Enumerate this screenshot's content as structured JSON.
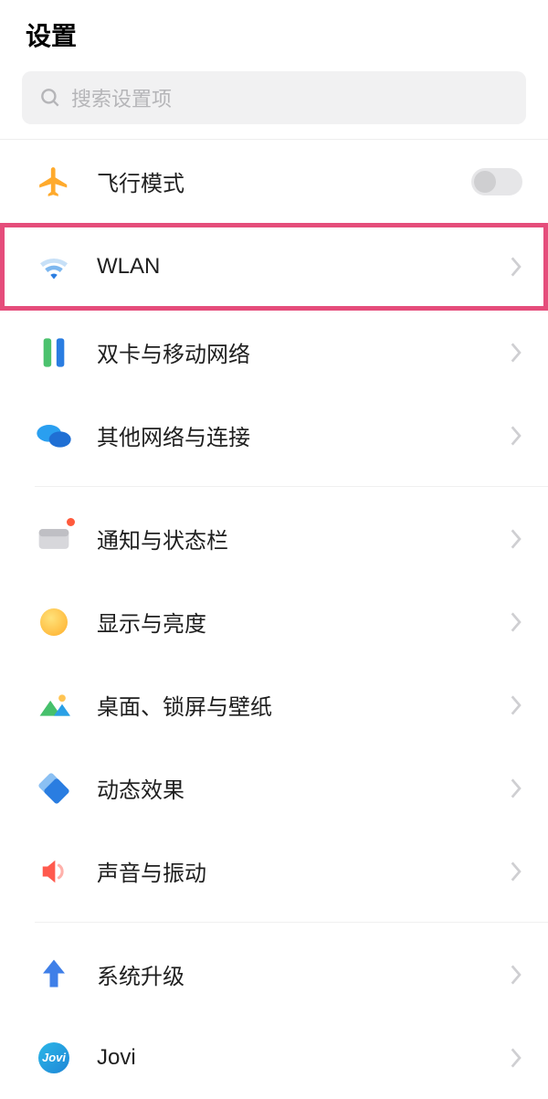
{
  "header": {
    "title": "设置"
  },
  "search": {
    "placeholder": "搜索设置项"
  },
  "groups": [
    {
      "items": [
        {
          "id": "airplane",
          "label": "飞行模式",
          "control": "toggle",
          "toggled": false
        },
        {
          "id": "wlan",
          "label": "WLAN",
          "control": "chevron",
          "highlighted": true
        },
        {
          "id": "dualsim",
          "label": "双卡与移动网络",
          "control": "chevron"
        },
        {
          "id": "othernet",
          "label": "其他网络与连接",
          "control": "chevron"
        }
      ]
    },
    {
      "items": [
        {
          "id": "notif",
          "label": "通知与状态栏",
          "control": "chevron"
        },
        {
          "id": "display",
          "label": "显示与亮度",
          "control": "chevron"
        },
        {
          "id": "wallpaper",
          "label": "桌面、锁屏与壁纸",
          "control": "chevron"
        },
        {
          "id": "motion",
          "label": "动态效果",
          "control": "chevron"
        },
        {
          "id": "sound",
          "label": "声音与振动",
          "control": "chevron"
        }
      ]
    },
    {
      "items": [
        {
          "id": "upgrade",
          "label": "系统升级",
          "control": "chevron"
        },
        {
          "id": "jovi",
          "label": "Jovi",
          "control": "chevron"
        }
      ]
    }
  ],
  "jovi_text": "Jovi"
}
